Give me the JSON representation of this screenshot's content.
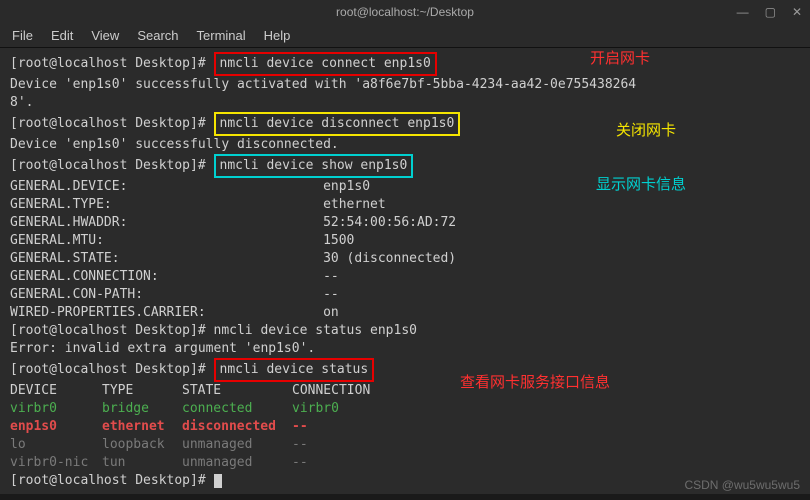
{
  "titlebar": {
    "title": "root@localhost:~/Desktop"
  },
  "menubar": [
    "File",
    "Edit",
    "View",
    "Search",
    "Terminal",
    "Help"
  ],
  "prompt": "[root@localhost Desktop]# ",
  "cmd1": "nmcli device connect enp1s0",
  "out1a": "Device 'enp1s0' successfully activated with 'a8f6e7bf-5bba-4234-aa42-0e7554382648'.",
  "cmd2": "nmcli device disconnect enp1s0",
  "out2": "Device 'enp1s0' successfully disconnected.",
  "cmd3": "nmcli device show enp1s0",
  "show": [
    {
      "k": "GENERAL.DEVICE:",
      "v": "enp1s0"
    },
    {
      "k": "GENERAL.TYPE:",
      "v": "ethernet"
    },
    {
      "k": "GENERAL.HWADDR:",
      "v": "52:54:00:56:AD:72"
    },
    {
      "k": "GENERAL.MTU:",
      "v": "1500"
    },
    {
      "k": "GENERAL.STATE:",
      "v": "30 (disconnected)"
    },
    {
      "k": "GENERAL.CONNECTION:",
      "v": "--"
    },
    {
      "k": "GENERAL.CON-PATH:",
      "v": "--"
    },
    {
      "k": "WIRED-PROPERTIES.CARRIER:",
      "v": "on"
    }
  ],
  "cmd4": "nmcli device status enp1s0",
  "err": "Error: invalid extra argument 'enp1s0'.",
  "cmd5": "nmcli device status",
  "table": {
    "headers": [
      "DEVICE",
      "TYPE",
      "STATE",
      "CONNECTION"
    ],
    "rows": [
      [
        "virbr0",
        "bridge",
        "connected",
        "virbr0",
        "green"
      ],
      [
        "enp1s0",
        "ethernet",
        "disconnected",
        "--",
        "red"
      ],
      [
        "lo",
        "loopback",
        "unmanaged",
        "--",
        "grey"
      ],
      [
        "virbr0-nic",
        "tun",
        "unmanaged",
        "--",
        "grey"
      ]
    ]
  },
  "annot": {
    "a1": "开启网卡",
    "a2": "关闭网卡",
    "a3": "显示网卡信息",
    "a4": "查看网卡服务接口信息"
  },
  "watermark": "CSDN @wu5wu5wu5"
}
